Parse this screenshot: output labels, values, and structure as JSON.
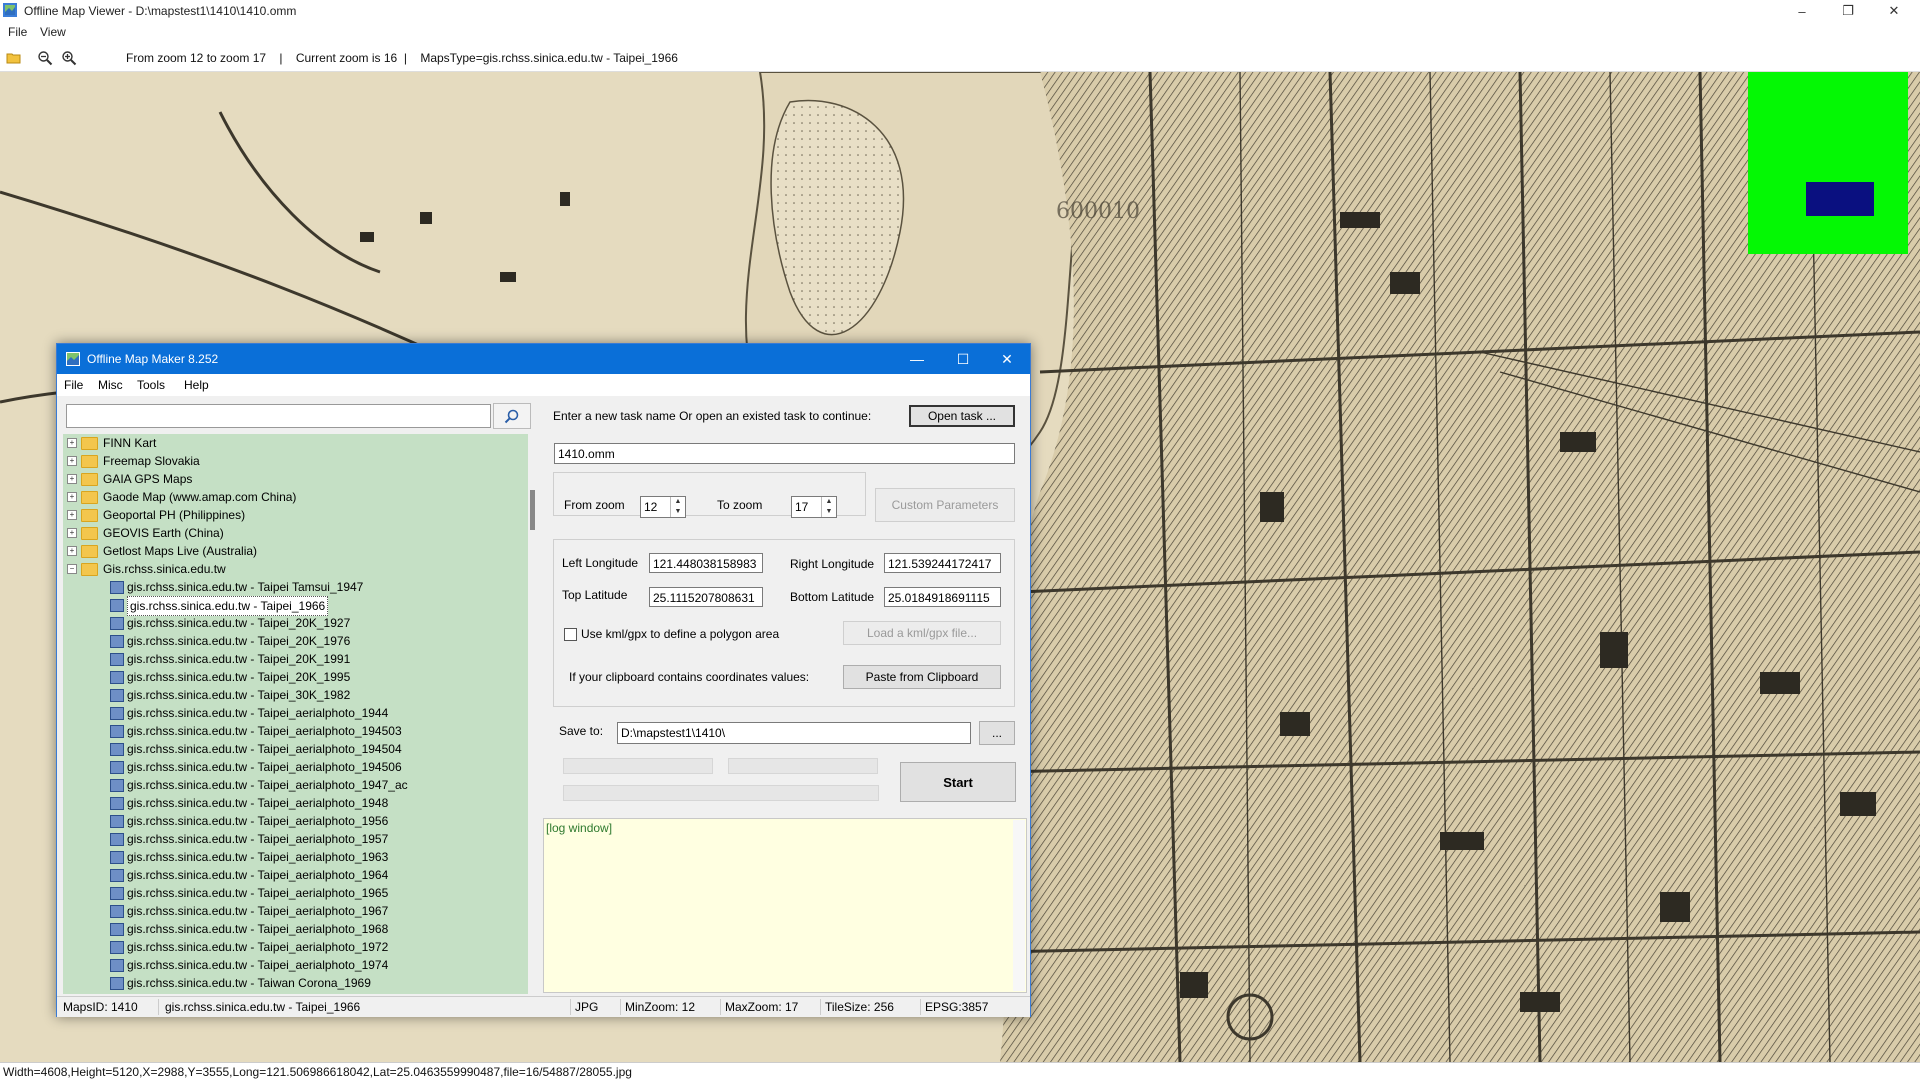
{
  "app": {
    "title": "Offline Map Viewer - D:\\mapstest1\\1410\\1410.omm",
    "menu": [
      "File",
      "View"
    ],
    "toolbar_info": "From zoom 12 to zoom 17    |    Current zoom is 16  |    MapsType=gis.rchss.sinica.edu.tw - Taipei_1966",
    "caption_buttons": [
      "–",
      "❐",
      "✕"
    ],
    "status": "Width=4608,Height=5120,X=2988,Y=3555,Long=121.506986618042,Lat=25.0463559990487,file=16/54887/28055.jpg",
    "map_watermark": "600010",
    "overview_colors": {
      "background": "#04f804",
      "viewport": "#0a1080"
    },
    "icons": [
      "app-icon",
      "open-folder-icon",
      "zoom-out-icon",
      "zoom-in-icon"
    ]
  },
  "dialog": {
    "title": "Offline Map Maker 8.252",
    "caption_buttons": [
      "—",
      "☐",
      "✕"
    ],
    "menu": [
      "File",
      "Misc",
      "Tools",
      "Help"
    ],
    "search": {
      "value": "",
      "icon": "search-icon"
    },
    "tree": {
      "folders": [
        {
          "label": "FINN Kart",
          "expanded": false
        },
        {
          "label": "Freemap Slovakia",
          "expanded": false
        },
        {
          "label": "GAIA GPS Maps",
          "expanded": false
        },
        {
          "label": "Gaode Map (www.amap.com China)",
          "expanded": false
        },
        {
          "label": "Geoportal PH (Philippines)",
          "expanded": false
        },
        {
          "label": "GEOVIS Earth (China)",
          "expanded": false
        },
        {
          "label": "Getlost Maps Live (Australia)",
          "expanded": false
        },
        {
          "label": "Gis.rchss.sinica.edu.tw",
          "expanded": true
        }
      ],
      "children": [
        "gis.rchss.sinica.edu.tw - Taipei Tamsui_1947",
        "gis.rchss.sinica.edu.tw - Taipei_1966",
        "gis.rchss.sinica.edu.tw - Taipei_20K_1927",
        "gis.rchss.sinica.edu.tw - Taipei_20K_1976",
        "gis.rchss.sinica.edu.tw - Taipei_20K_1991",
        "gis.rchss.sinica.edu.tw - Taipei_20K_1995",
        "gis.rchss.sinica.edu.tw - Taipei_30K_1982",
        "gis.rchss.sinica.edu.tw - Taipei_aerialphoto_1944",
        "gis.rchss.sinica.edu.tw - Taipei_aerialphoto_194503",
        "gis.rchss.sinica.edu.tw - Taipei_aerialphoto_194504",
        "gis.rchss.sinica.edu.tw - Taipei_aerialphoto_194506",
        "gis.rchss.sinica.edu.tw - Taipei_aerialphoto_1947_ac",
        "gis.rchss.sinica.edu.tw - Taipei_aerialphoto_1948",
        "gis.rchss.sinica.edu.tw - Taipei_aerialphoto_1956",
        "gis.rchss.sinica.edu.tw - Taipei_aerialphoto_1957",
        "gis.rchss.sinica.edu.tw - Taipei_aerialphoto_1963",
        "gis.rchss.sinica.edu.tw - Taipei_aerialphoto_1964",
        "gis.rchss.sinica.edu.tw - Taipei_aerialphoto_1965",
        "gis.rchss.sinica.edu.tw - Taipei_aerialphoto_1967",
        "gis.rchss.sinica.edu.tw - Taipei_aerialphoto_1968",
        "gis.rchss.sinica.edu.tw - Taipei_aerialphoto_1972",
        "gis.rchss.sinica.edu.tw - Taipei_aerialphoto_1974",
        "gis.rchss.sinica.edu.tw - Taiwan Corona_1969"
      ],
      "selected_child": 1
    },
    "task": {
      "prompt": "Enter a new task name Or open an existed task to continue:",
      "open_button": "Open task ...",
      "name": "1410.omm"
    },
    "zoom": {
      "from_label": "From zoom",
      "from_value": "12",
      "to_label": "To zoom",
      "to_value": "17",
      "custom_button": "Custom Parameters"
    },
    "bounds": {
      "left_label": "Left Longitude",
      "left_value": "121.448038158983",
      "right_label": "Right Longitude",
      "right_value": "121.539244172417",
      "top_label": "Top Latitude",
      "top_value": "25.1115207808631",
      "bottom_label": "Bottom Latitude",
      "bottom_value": "25.0184918691115",
      "kml_checkbox_label": "Use kml/gpx to define a polygon area",
      "kml_checked": false,
      "kml_button": "Load a kml/gpx file...",
      "clipboard_label": "If your clipboard contains coordinates values:",
      "clipboard_button": "Paste from Clipboard"
    },
    "save": {
      "label": "Save to:",
      "path": "D:\\mapstest1\\1410\\",
      "browse_button": "...",
      "start_button": "Start"
    },
    "log": "[log window]",
    "status": {
      "maps_id": "MapsID: 1410",
      "map_name": "gis.rchss.sinica.edu.tw - Taipei_1966",
      "format": "JPG",
      "min_zoom": "MinZoom: 12",
      "max_zoom": "MaxZoom: 17",
      "tile_size": "TileSize: 256",
      "epsg": "EPSG:3857"
    }
  }
}
